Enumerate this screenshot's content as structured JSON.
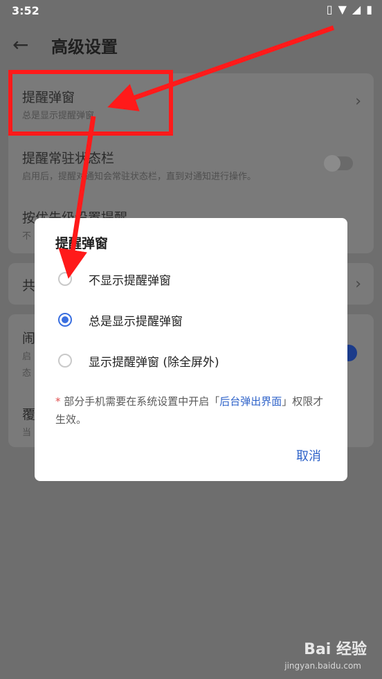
{
  "status_bar": {
    "time": "3:52"
  },
  "app_bar": {
    "title": "高级设置"
  },
  "settings": {
    "reminder_popup": {
      "label": "提醒弹窗",
      "sub": "总是显示提醒弹窗"
    },
    "persistent_statusbar": {
      "label": "提醒常驻状态栏",
      "sub": "启用后，提醒对通知会常驻状态栏，直到对通知进行操作。"
    },
    "priority_reminder": {
      "label": "按优先级设置提醒",
      "sub": "不"
    },
    "partial_1": {
      "label": "共"
    },
    "partial_2": {
      "label": "闹",
      "sub": "启",
      "sub2": "态"
    },
    "partial_3": {
      "label": "覆",
      "sub": "当"
    }
  },
  "dialog": {
    "title": "提醒弹窗",
    "options": [
      {
        "label": "不显示提醒弹窗",
        "checked": false
      },
      {
        "label": "总是显示提醒弹窗",
        "checked": true
      },
      {
        "label": "显示提醒弹窗 (除全屏外)",
        "checked": false
      }
    ],
    "note_star": "*",
    "note_prefix": " 部分手机需要在系统设置中开启「",
    "note_link": "后台弹出界面",
    "note_suffix": "」权限才生效。",
    "cancel_label": "取消"
  },
  "watermark": {
    "text": "Bai 经验",
    "url": "jingyan.baidu.com"
  }
}
